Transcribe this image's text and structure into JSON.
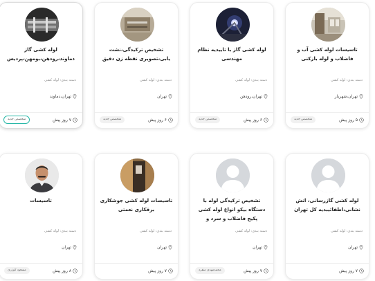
{
  "cards": [
    {
      "title": "تاسیسات لوله کشی آب و فاضلاب و لوله بازکنی",
      "category": "دسته بندی: لوله کشی",
      "location": "تهران،شهریار",
      "time": "۵ روز پیش",
      "badge": "متخصص جدید",
      "avatar": "bathroom-photo"
    },
    {
      "title": "لوله کشی گاز با تاییدیه نظام مهندسی",
      "category": "دسته بندی: لوله کشی",
      "location": "تهران،رودهن",
      "time": "۶ روز پیش",
      "badge": "متخصص جدید",
      "avatar": "welding-photo"
    },
    {
      "title": "تشخیص ترکیدگی،نشت یابی،تصویری نقطه زن دقیق",
      "category": "دسته بندی: لوله کشی",
      "location": "تهران",
      "time": "۶ روز پیش",
      "badge": "متخصص جدید",
      "avatar": "wall-pipe-photo"
    },
    {
      "title": "لوله کشی گاز دماوند،رودهن،بومهن،پردیس",
      "category": "دسته بندی: لوله کشی",
      "location": "تهران،دماوند",
      "time": "۷ روز پیش",
      "badge": "متخصص جدید",
      "avatar": "pipe-tools-photo"
    },
    {
      "title": "لوله کشی گازرسانی، اتش نشانی،اطفائیبدیه کل تهران",
      "category": "دسته بندی: لوله کشی",
      "location": "تهران",
      "time": "۷ روز پیش",
      "badge": "",
      "avatar": "default-user"
    },
    {
      "title": "تشخیص ترکیدگی لوله با دستگاه بیکو انواع لوله کشی پکیج فاضلاب و سرد و",
      "category": "دسته بندی: لوله کشی",
      "location": "تهران",
      "time": "۷ روز پیش",
      "badge": "محمدمهدی منفرد",
      "avatar": "default-user"
    },
    {
      "title": "تاسیسات لوله کشی جوشکاری برقکاری نعمتی",
      "category": "دسته بندی: لوله کشی",
      "location": "تهران",
      "time": "۷ روز پیش",
      "badge": "",
      "avatar": "doorway-photo"
    },
    {
      "title": "تاسیسات",
      "category": "دسته بندی: لوله کشی",
      "location": "تهران",
      "time": "۸ روز پیش",
      "badge": "مسعود کوزری",
      "avatar": "man-portrait"
    }
  ],
  "colors": {
    "highlight_border": "#27b7a7",
    "card_border": "#ececec",
    "muted_text": "#8a8a8a"
  }
}
